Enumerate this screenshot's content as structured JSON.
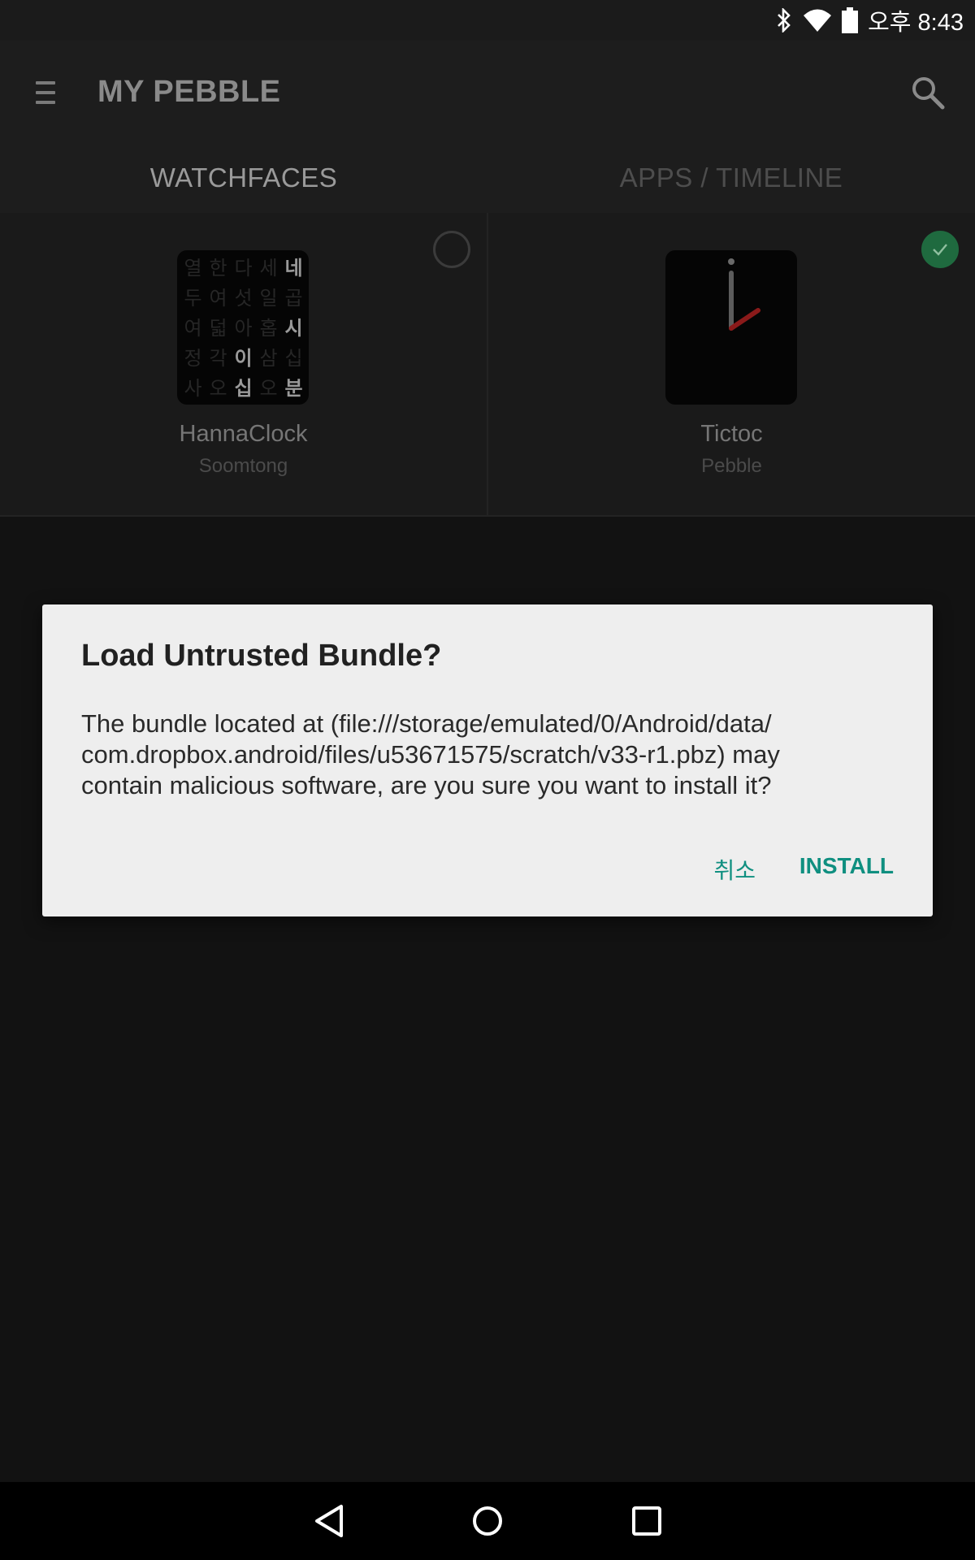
{
  "status_bar": {
    "time": "오후 8:43",
    "icons": [
      "bluetooth-icon",
      "wifi-icon",
      "battery-icon"
    ]
  },
  "app_bar": {
    "title": "MY PEBBLE",
    "menu_icon": "menu-icon",
    "search_icon": "search-icon"
  },
  "tabs": [
    {
      "label": "WATCHFACES",
      "active": true
    },
    {
      "label": "APPS / TIMELINE",
      "active": false
    }
  ],
  "watchfaces": [
    {
      "name": "HannaClock",
      "author": "Soomtong",
      "selected": false,
      "grid": [
        [
          "열",
          "한",
          "다",
          "세",
          "네"
        ],
        [
          "두",
          "여",
          "섯",
          "일",
          "곱"
        ],
        [
          "여",
          "덟",
          "아",
          "홉",
          "시"
        ],
        [
          "정",
          "각",
          "이",
          "삼",
          "십"
        ],
        [
          "사",
          "오",
          "십",
          "오",
          "분"
        ]
      ]
    },
    {
      "name": "Tictoc",
      "author": "Pebble",
      "selected": true
    }
  ],
  "dialog": {
    "title": "Load Untrusted Bundle?",
    "message_lines": [
      "The bundle located at (file:///storage/emulated/0/Android/data/",
      "com.dropbox.android/files/u53671575/scratch/v33-r1.pbz) may",
      "contain malicious software, are you sure you want to install it?"
    ],
    "cancel_label": "취소",
    "install_label": "INSTALL"
  },
  "colors": {
    "accent": "#0f8f80",
    "selected_check": "#1f6a3f"
  },
  "nav_bar": [
    "back-icon",
    "home-icon",
    "recents-icon"
  ]
}
